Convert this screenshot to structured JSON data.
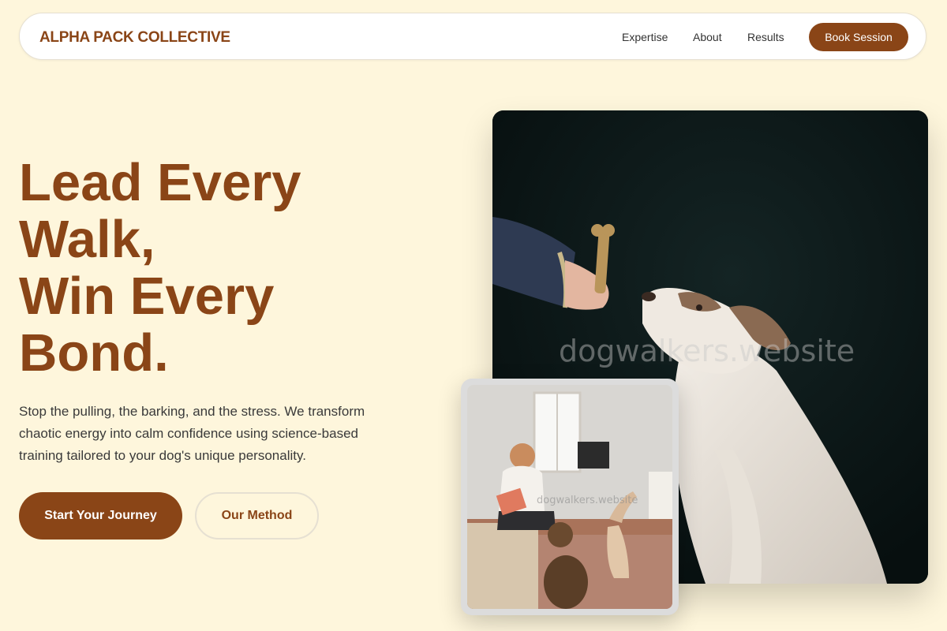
{
  "brand": {
    "name": "ALPHA PACK COLLECTIVE"
  },
  "nav": {
    "links": [
      "Expertise",
      "About",
      "Results"
    ],
    "cta": "Book Session"
  },
  "hero": {
    "headline_lines": [
      "Lead Every",
      "Walk,",
      "Win Every",
      "Bond."
    ],
    "lede": "Stop the pulling, the barking, and the stress. We transform chaotic energy into calm confidence using science-based training tailored to your dog's unique personality.",
    "primary_cta": "Start Your Journey",
    "secondary_cta": "Our Method"
  },
  "images": {
    "main_watermark": "dogwalkers.website",
    "inset_watermark": "dogwalkers.website"
  },
  "colors": {
    "background": "#fef6dc",
    "accent": "#8a4517",
    "nav_background": "#ffffff"
  }
}
